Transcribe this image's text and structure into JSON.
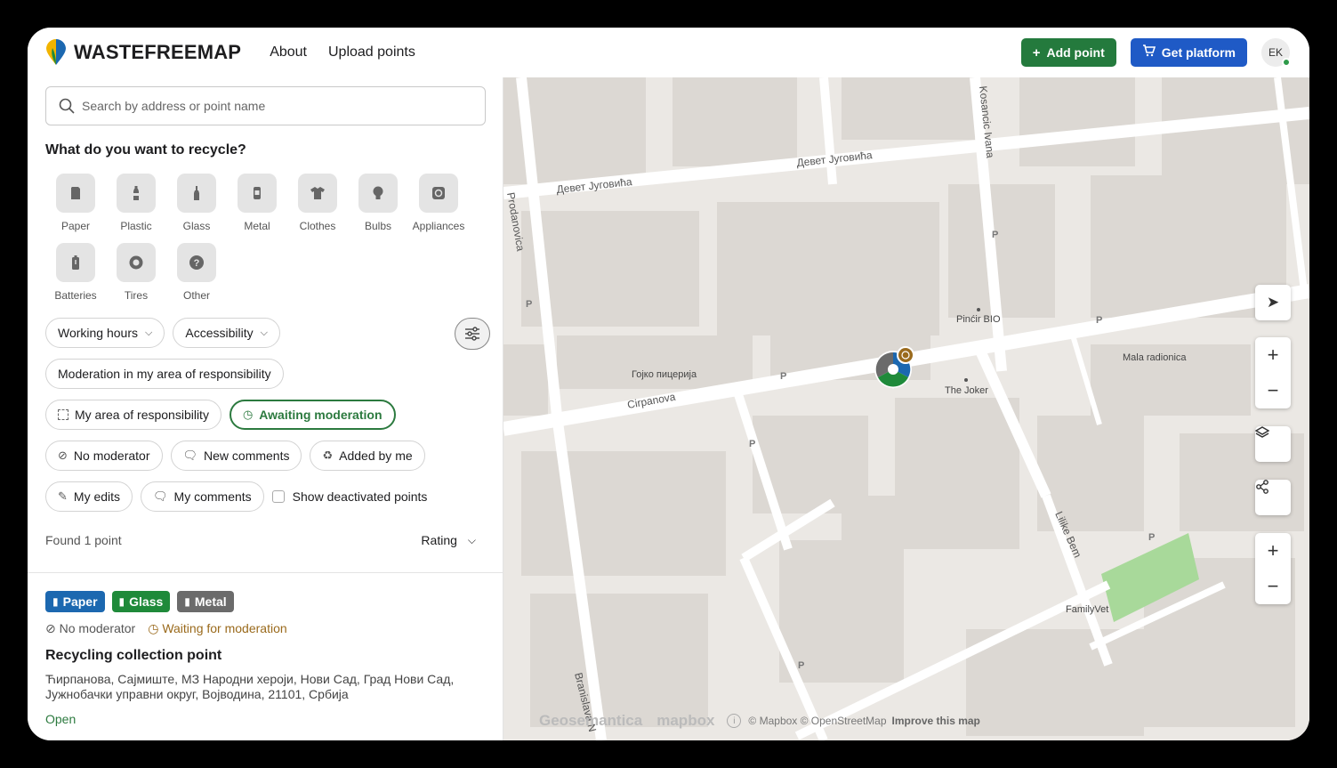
{
  "header": {
    "brand": "WASTEFREEMAP",
    "nav": [
      "About",
      "Upload points"
    ],
    "add_point": "Add point",
    "get_platform": "Get platform",
    "avatar": "EK"
  },
  "sidebar": {
    "search_placeholder": "Search by address or point name",
    "question": "What do you want to recycle?",
    "categories": [
      "Paper",
      "Plastic",
      "Glass",
      "Metal",
      "Clothes",
      "Bulbs",
      "Appliances",
      "Batteries",
      "Tires",
      "Other"
    ],
    "filters": {
      "working_hours": "Working hours",
      "accessibility": "Accessibility",
      "moderation_area": "Moderation in my area of responsibility",
      "my_area": "My area of responsibility",
      "awaiting": "Awaiting moderation",
      "no_moderator": "No moderator",
      "new_comments": "New comments",
      "added_by_me": "Added by me",
      "my_edits": "My edits",
      "my_comments": "My comments",
      "show_deactivated": "Show deactivated points"
    },
    "found": "Found 1 point",
    "sort": "Rating"
  },
  "result": {
    "tags": [
      "Paper",
      "Glass",
      "Metal"
    ],
    "moderator_status": "No moderator",
    "moderation_status": "Waiting for moderation",
    "title": "Recycling collection point",
    "address": "Ћирпанова, Сајмиште, МЗ Народни хероји, Нови Сад, Град Нови Сад, Јужнобачки управни округ, Војводина, 21101, Србија",
    "hours": "Open"
  },
  "map": {
    "streets": [
      "Девет Југовића",
      "Девет Југовића",
      "Cirpanova",
      "Kosancic Ivana",
      "Lilike Bem",
      "Branislava N",
      "Prodanovica"
    ],
    "pois": [
      "Pinćir BIO",
      "Гојко пицерија",
      "The Joker",
      "Mala radionica",
      "FamilyVet"
    ],
    "attribution": {
      "geo": "Geosemantica",
      "mapbox": "mapbox",
      "credits": "© Mapbox © OpenStreetMap",
      "improve": "Improve this map"
    },
    "colors": {
      "building": "#dcd8d3",
      "road": "#ffffff",
      "park": "#a8d99a",
      "background": "#ebe8e4"
    }
  },
  "colors": {
    "green": "#247a3d",
    "blue": "#1f5ac6",
    "paper": "#1c68b0",
    "glass": "#1f8a3a",
    "metal": "#6b6b6b",
    "waiting": "#9a6a1c"
  }
}
